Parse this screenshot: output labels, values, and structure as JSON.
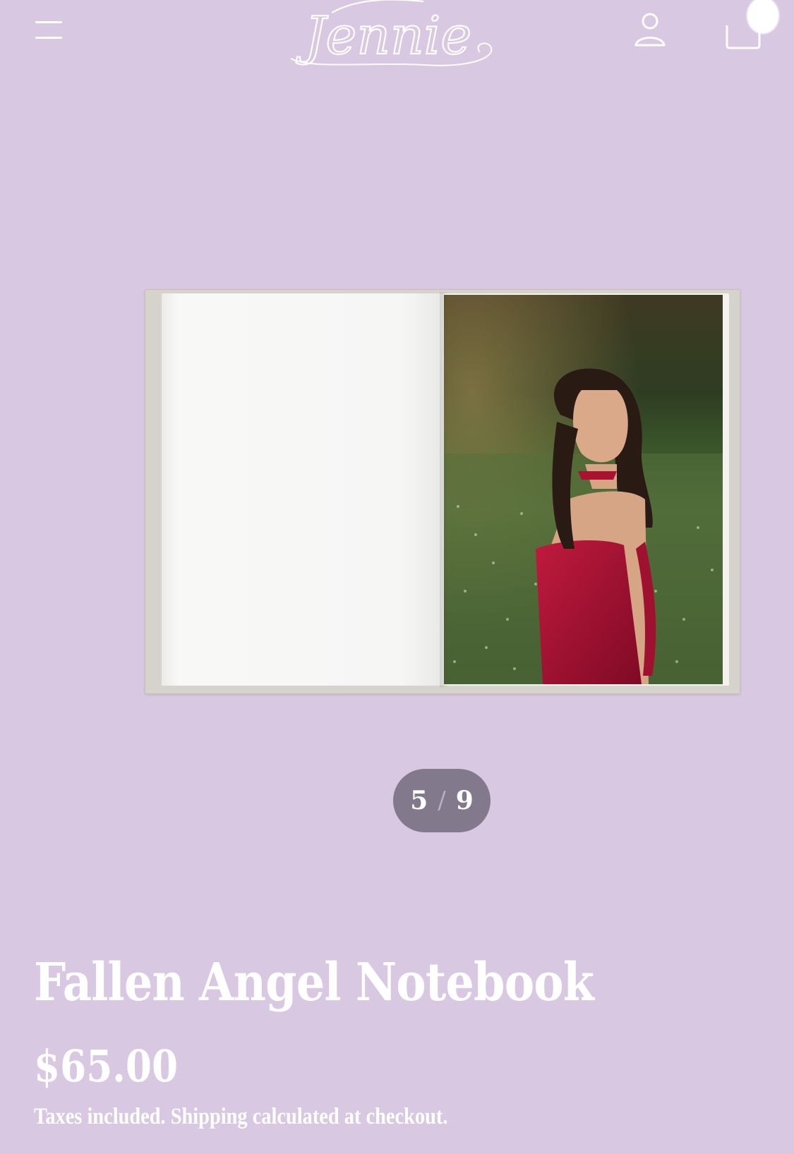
{
  "header": {
    "logo_text": "Jennie",
    "menu_icon": "hamburger-menu-icon",
    "account_icon": "user-account-icon",
    "cart_icon": "shopping-bag-icon"
  },
  "gallery": {
    "current": "5",
    "separator": "/",
    "total": "9"
  },
  "product": {
    "title": "Fallen Angel Notebook",
    "price": "$65.00",
    "tax_note": "Taxes included. Shipping calculated at checkout."
  },
  "colors": {
    "background": "#d8c8e1",
    "counter_pill": "#827a8c",
    "text": "#ffffff"
  }
}
